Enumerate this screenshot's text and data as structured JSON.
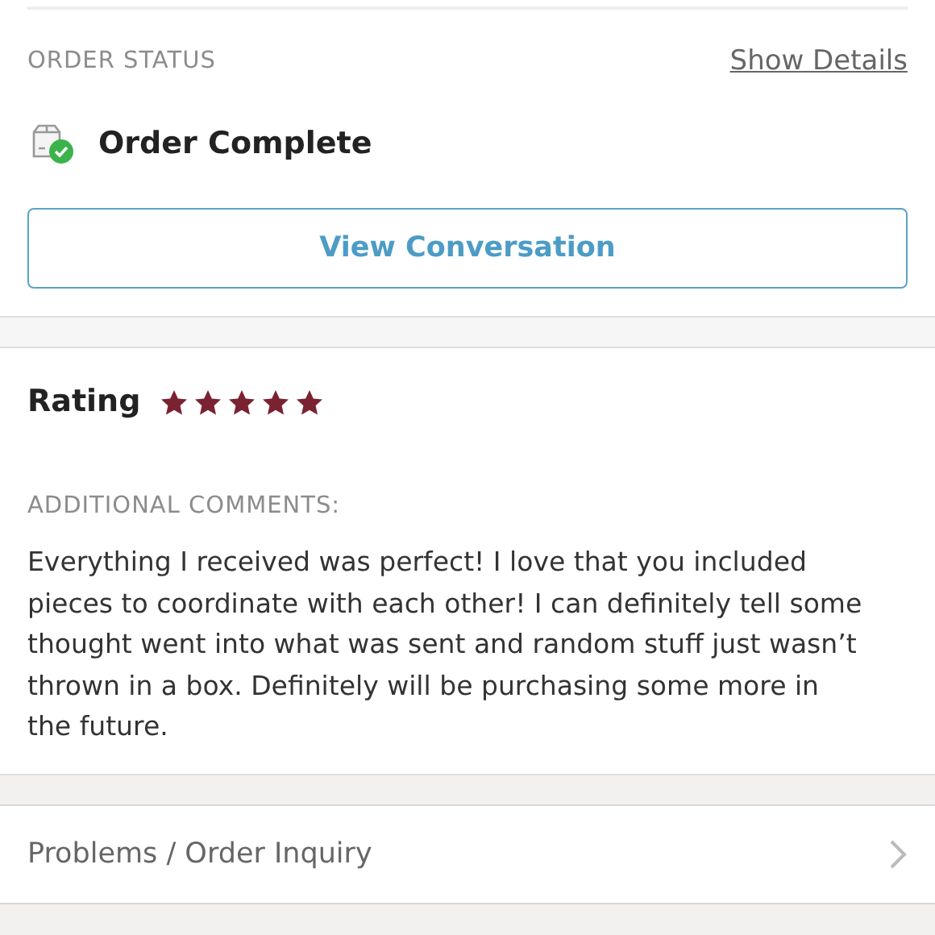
{
  "order_status": {
    "heading": "ORDER STATUS",
    "details_link": "Show Details",
    "status": "Order Complete",
    "button": "View Conversation"
  },
  "rating": {
    "label": "Rating",
    "stars": 5
  },
  "comments": {
    "heading": "ADDITIONAL COMMENTS:",
    "text": "Everything I received was perfect! I love that you included pieces to coordinate with each other! I can definitely tell some thought went into what was sent and random stuff just wasn’t thrown in a box. Definitely will be purchasing some more in the future."
  },
  "inquiry": {
    "label": "Problems / Order Inquiry"
  }
}
